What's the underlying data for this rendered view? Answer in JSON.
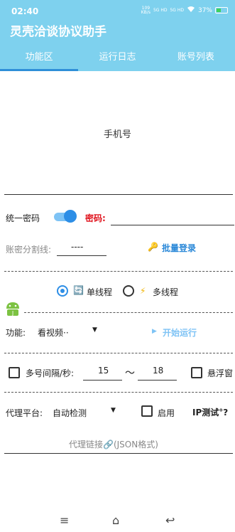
{
  "status_bar": {
    "time": "02:40",
    "net_speed": "109\nKB/s",
    "sig1": "5G HD",
    "sig2": "5G HD",
    "battery": "37%"
  },
  "app": {
    "title": "灵壳洽谈协议助手"
  },
  "tabs": [
    {
      "label": "功能区",
      "active": true
    },
    {
      "label": "运行日志"
    },
    {
      "label": "账号列表"
    }
  ],
  "phone": {
    "placeholder": "手机号"
  },
  "password": {
    "unified_label": "统一密码",
    "unified_on": true,
    "label": "密码:"
  },
  "separator": {
    "label": "账密分割线:",
    "value": "----"
  },
  "batch_login": {
    "label": "批量登录",
    "icon": "key-icon"
  },
  "threads": {
    "single_label": "单线程",
    "multi_label": "多线程",
    "selected": "single"
  },
  "function": {
    "label": "功能:",
    "value": "看视频··",
    "start_label": "开始运行"
  },
  "interval": {
    "label": "多号间隔/秒:",
    "min": "15",
    "tilde": "～",
    "max": "18",
    "float_label": "悬浮窗"
  },
  "proxy": {
    "label": "代理平台:",
    "value": "自动检测",
    "enable_label": "启用",
    "ip_test": "IP测试",
    "ip_test_suffix": "°?",
    "link_placeholder": "代理链接🔗(JSON格式)"
  },
  "navbar": {
    "menu": "≡",
    "home": "⌂",
    "back": "↩"
  },
  "colors": {
    "header": "#7ed1ee",
    "accent": "#2d8ee6",
    "red_label": "#e0141e"
  }
}
